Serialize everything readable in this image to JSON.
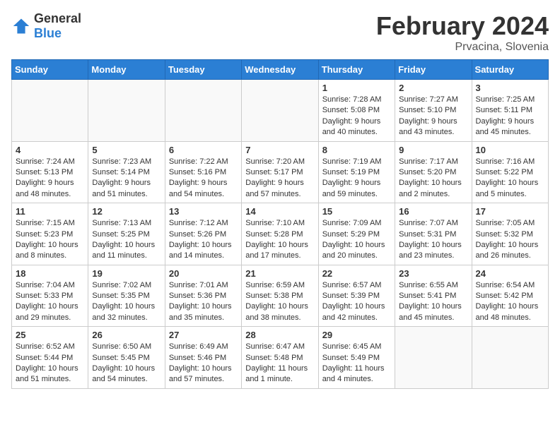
{
  "header": {
    "logo_general": "General",
    "logo_blue": "Blue",
    "month_title": "February 2024",
    "location": "Prvacina, Slovenia"
  },
  "days_of_week": [
    "Sunday",
    "Monday",
    "Tuesday",
    "Wednesday",
    "Thursday",
    "Friday",
    "Saturday"
  ],
  "weeks": [
    [
      {
        "day": "",
        "info": ""
      },
      {
        "day": "",
        "info": ""
      },
      {
        "day": "",
        "info": ""
      },
      {
        "day": "",
        "info": ""
      },
      {
        "day": "1",
        "info": "Sunrise: 7:28 AM\nSunset: 5:08 PM\nDaylight: 9 hours\nand 40 minutes."
      },
      {
        "day": "2",
        "info": "Sunrise: 7:27 AM\nSunset: 5:10 PM\nDaylight: 9 hours\nand 43 minutes."
      },
      {
        "day": "3",
        "info": "Sunrise: 7:25 AM\nSunset: 5:11 PM\nDaylight: 9 hours\nand 45 minutes."
      }
    ],
    [
      {
        "day": "4",
        "info": "Sunrise: 7:24 AM\nSunset: 5:13 PM\nDaylight: 9 hours\nand 48 minutes."
      },
      {
        "day": "5",
        "info": "Sunrise: 7:23 AM\nSunset: 5:14 PM\nDaylight: 9 hours\nand 51 minutes."
      },
      {
        "day": "6",
        "info": "Sunrise: 7:22 AM\nSunset: 5:16 PM\nDaylight: 9 hours\nand 54 minutes."
      },
      {
        "day": "7",
        "info": "Sunrise: 7:20 AM\nSunset: 5:17 PM\nDaylight: 9 hours\nand 57 minutes."
      },
      {
        "day": "8",
        "info": "Sunrise: 7:19 AM\nSunset: 5:19 PM\nDaylight: 9 hours\nand 59 minutes."
      },
      {
        "day": "9",
        "info": "Sunrise: 7:17 AM\nSunset: 5:20 PM\nDaylight: 10 hours\nand 2 minutes."
      },
      {
        "day": "10",
        "info": "Sunrise: 7:16 AM\nSunset: 5:22 PM\nDaylight: 10 hours\nand 5 minutes."
      }
    ],
    [
      {
        "day": "11",
        "info": "Sunrise: 7:15 AM\nSunset: 5:23 PM\nDaylight: 10 hours\nand 8 minutes."
      },
      {
        "day": "12",
        "info": "Sunrise: 7:13 AM\nSunset: 5:25 PM\nDaylight: 10 hours\nand 11 minutes."
      },
      {
        "day": "13",
        "info": "Sunrise: 7:12 AM\nSunset: 5:26 PM\nDaylight: 10 hours\nand 14 minutes."
      },
      {
        "day": "14",
        "info": "Sunrise: 7:10 AM\nSunset: 5:28 PM\nDaylight: 10 hours\nand 17 minutes."
      },
      {
        "day": "15",
        "info": "Sunrise: 7:09 AM\nSunset: 5:29 PM\nDaylight: 10 hours\nand 20 minutes."
      },
      {
        "day": "16",
        "info": "Sunrise: 7:07 AM\nSunset: 5:31 PM\nDaylight: 10 hours\nand 23 minutes."
      },
      {
        "day": "17",
        "info": "Sunrise: 7:05 AM\nSunset: 5:32 PM\nDaylight: 10 hours\nand 26 minutes."
      }
    ],
    [
      {
        "day": "18",
        "info": "Sunrise: 7:04 AM\nSunset: 5:33 PM\nDaylight: 10 hours\nand 29 minutes."
      },
      {
        "day": "19",
        "info": "Sunrise: 7:02 AM\nSunset: 5:35 PM\nDaylight: 10 hours\nand 32 minutes."
      },
      {
        "day": "20",
        "info": "Sunrise: 7:01 AM\nSunset: 5:36 PM\nDaylight: 10 hours\nand 35 minutes."
      },
      {
        "day": "21",
        "info": "Sunrise: 6:59 AM\nSunset: 5:38 PM\nDaylight: 10 hours\nand 38 minutes."
      },
      {
        "day": "22",
        "info": "Sunrise: 6:57 AM\nSunset: 5:39 PM\nDaylight: 10 hours\nand 42 minutes."
      },
      {
        "day": "23",
        "info": "Sunrise: 6:55 AM\nSunset: 5:41 PM\nDaylight: 10 hours\nand 45 minutes."
      },
      {
        "day": "24",
        "info": "Sunrise: 6:54 AM\nSunset: 5:42 PM\nDaylight: 10 hours\nand 48 minutes."
      }
    ],
    [
      {
        "day": "25",
        "info": "Sunrise: 6:52 AM\nSunset: 5:44 PM\nDaylight: 10 hours\nand 51 minutes."
      },
      {
        "day": "26",
        "info": "Sunrise: 6:50 AM\nSunset: 5:45 PM\nDaylight: 10 hours\nand 54 minutes."
      },
      {
        "day": "27",
        "info": "Sunrise: 6:49 AM\nSunset: 5:46 PM\nDaylight: 10 hours\nand 57 minutes."
      },
      {
        "day": "28",
        "info": "Sunrise: 6:47 AM\nSunset: 5:48 PM\nDaylight: 11 hours\nand 1 minute."
      },
      {
        "day": "29",
        "info": "Sunrise: 6:45 AM\nSunset: 5:49 PM\nDaylight: 11 hours\nand 4 minutes."
      },
      {
        "day": "",
        "info": ""
      },
      {
        "day": "",
        "info": ""
      }
    ]
  ]
}
